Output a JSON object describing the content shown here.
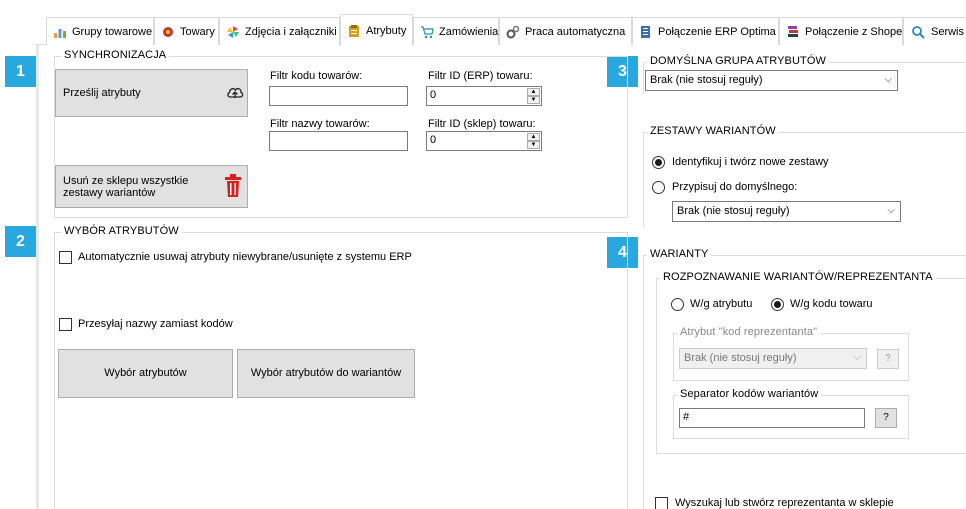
{
  "tabs": [
    {
      "label": "Grupy towarowe",
      "icon": "bar-chart-icon"
    },
    {
      "label": "Towary",
      "icon": "products-icon"
    },
    {
      "label": "Zdjęcia i załączniki",
      "icon": "pinwheel-icon"
    },
    {
      "label": "Atrybuty",
      "icon": "clipboard-icon",
      "active": true
    },
    {
      "label": "Zamówienia",
      "icon": "cart-icon"
    },
    {
      "label": "Praca automatyczna",
      "icon": "gears-icon"
    },
    {
      "label": "Połączenie ERP Optima",
      "icon": "erp-icon"
    },
    {
      "label": "Połączenie z Shoper",
      "icon": "books-icon"
    },
    {
      "label": "Serwis",
      "icon": "magnifier-icon"
    }
  ],
  "badges": [
    "1",
    "2",
    "3",
    "4"
  ],
  "sync": {
    "title": "SYNCHRONIZACJA",
    "send_button": "Prześlij atrybuty",
    "filter_code_label": "Filtr kodu towarów:",
    "filter_code_value": "",
    "filter_erp_label": "Filtr ID (ERP) towaru:",
    "filter_erp_value": "0",
    "filter_name_label": "Filtr nazwy towarów:",
    "filter_name_value": "",
    "filter_shop_label": "Filtr ID (sklep) towaru:",
    "filter_shop_value": "0",
    "delete_button_line1": "Usuń ze sklepu wszystkie",
    "delete_button_line2": "zestawy wariantów"
  },
  "attr_select": {
    "title": "WYBÓR ATRYBUTÓW",
    "auto_remove_label": "Automatycznie usuwaj atrybuty niewybrane/usunięte z systemu ERP",
    "send_names_label": "Przesyłaj nazwy zamiast kodów",
    "choose_button": "Wybór atrybutów",
    "choose_variants_button": "Wybór atrybutów do wariantów"
  },
  "default_group": {
    "title": "DOMYŚLNA GRUPA ATRYBUTÓW",
    "selected": "Brak (nie stosuj reguły)"
  },
  "variant_sets": {
    "title": "ZESTAWY WARIANTÓW",
    "option1": "Identyfikuj i twórz nowe zestawy",
    "option2": "Przypisuj do domyślnego:",
    "selected": "Brak (nie stosuj reguły)"
  },
  "variants": {
    "title": "WARIANTY",
    "recognition_title": "ROZPOZNAWANIE WARIANTÓW/REPREZENTANTA",
    "by_attr": "W/g atrybutu",
    "by_code": "W/g kodu towaru",
    "rep_attr_title": "Atrybut \"kod reprezentanta\"",
    "rep_attr_selected": "Brak (nie stosuj reguły)",
    "help": "?",
    "separator_title": "Separator kodów wariantów",
    "separator_value": "#",
    "find_rep_label": "Wyszukaj lub stwórz reprezentanta w sklepie"
  }
}
